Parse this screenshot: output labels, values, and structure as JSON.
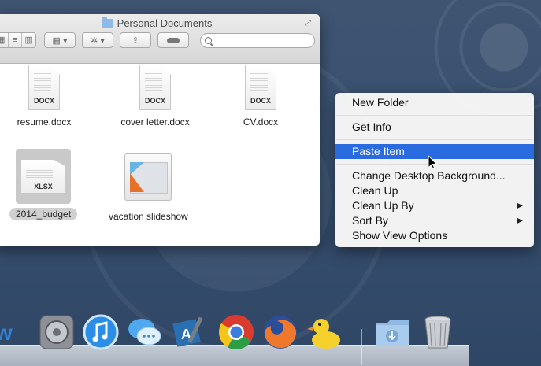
{
  "finder": {
    "title": "Personal Documents",
    "toolbar": {
      "view_icons": [
        "icon-view-icon",
        "list-view-icon",
        "column-view-icon"
      ],
      "arrange_label": "▦ ▾",
      "action_label": "✲ ▾",
      "share_label": "⇪"
    },
    "search_placeholder": "",
    "files": [
      {
        "name": "resume.docx",
        "ext": "DOCX"
      },
      {
        "name": "cover letter.docx",
        "ext": "DOCX"
      },
      {
        "name": "CV.docx",
        "ext": "DOCX"
      },
      {
        "name": "2014_budget",
        "ext": "XLSX",
        "selected": true
      },
      {
        "name": "vacation slideshow",
        "ext": ""
      }
    ]
  },
  "context_menu": {
    "items": [
      {
        "label": "New Folder"
      },
      {
        "label": "Get Info"
      },
      {
        "label": "Paste Item",
        "highlighted": true
      },
      {
        "label": "Change Desktop Background..."
      },
      {
        "label": "Clean Up"
      },
      {
        "label": "Clean Up By",
        "submenu": "▶"
      },
      {
        "label": "Sort By",
        "submenu": "▶"
      },
      {
        "label": "Show View Options"
      }
    ]
  },
  "dock": {
    "apps": [
      "partial-app-icon",
      "system-preferences-icon",
      "itunes-icon",
      "messages-icon",
      "xcode-icon",
      "chrome-icon",
      "firefox-icon",
      "cyberduck-icon",
      "downloads-folder-icon",
      "trash-icon"
    ]
  },
  "colors": {
    "menu_highlight": "#2a6ce0",
    "desktop": "#385070"
  }
}
